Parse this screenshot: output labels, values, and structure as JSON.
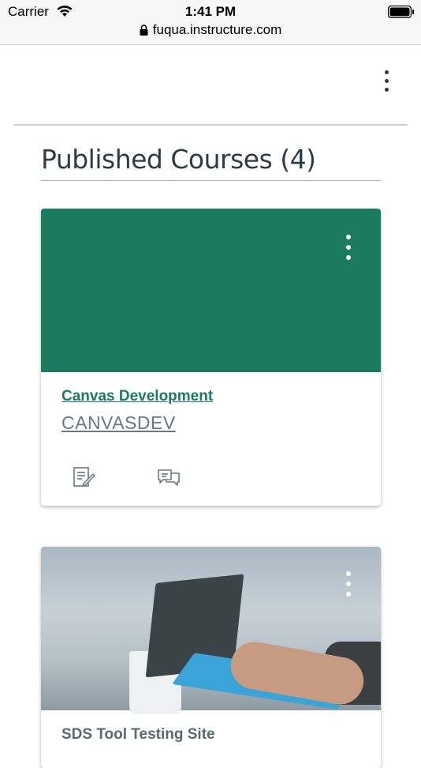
{
  "status_bar": {
    "carrier": "Carrier",
    "time": "1:41 PM",
    "url": "fuqua.instructure.com"
  },
  "section": {
    "title": "Published Courses (4)"
  },
  "courses": [
    {
      "name": "Canvas Development",
      "code": "CANVASDEV",
      "color": "#1b7a60",
      "icons": [
        "assignments-icon",
        "discussions-icon"
      ]
    },
    {
      "name": "SDS Tool Testing Site",
      "code": "",
      "color": "#5a6870"
    }
  ],
  "colors": {
    "text": "#2d3b45",
    "accent": "#1b7a60"
  }
}
